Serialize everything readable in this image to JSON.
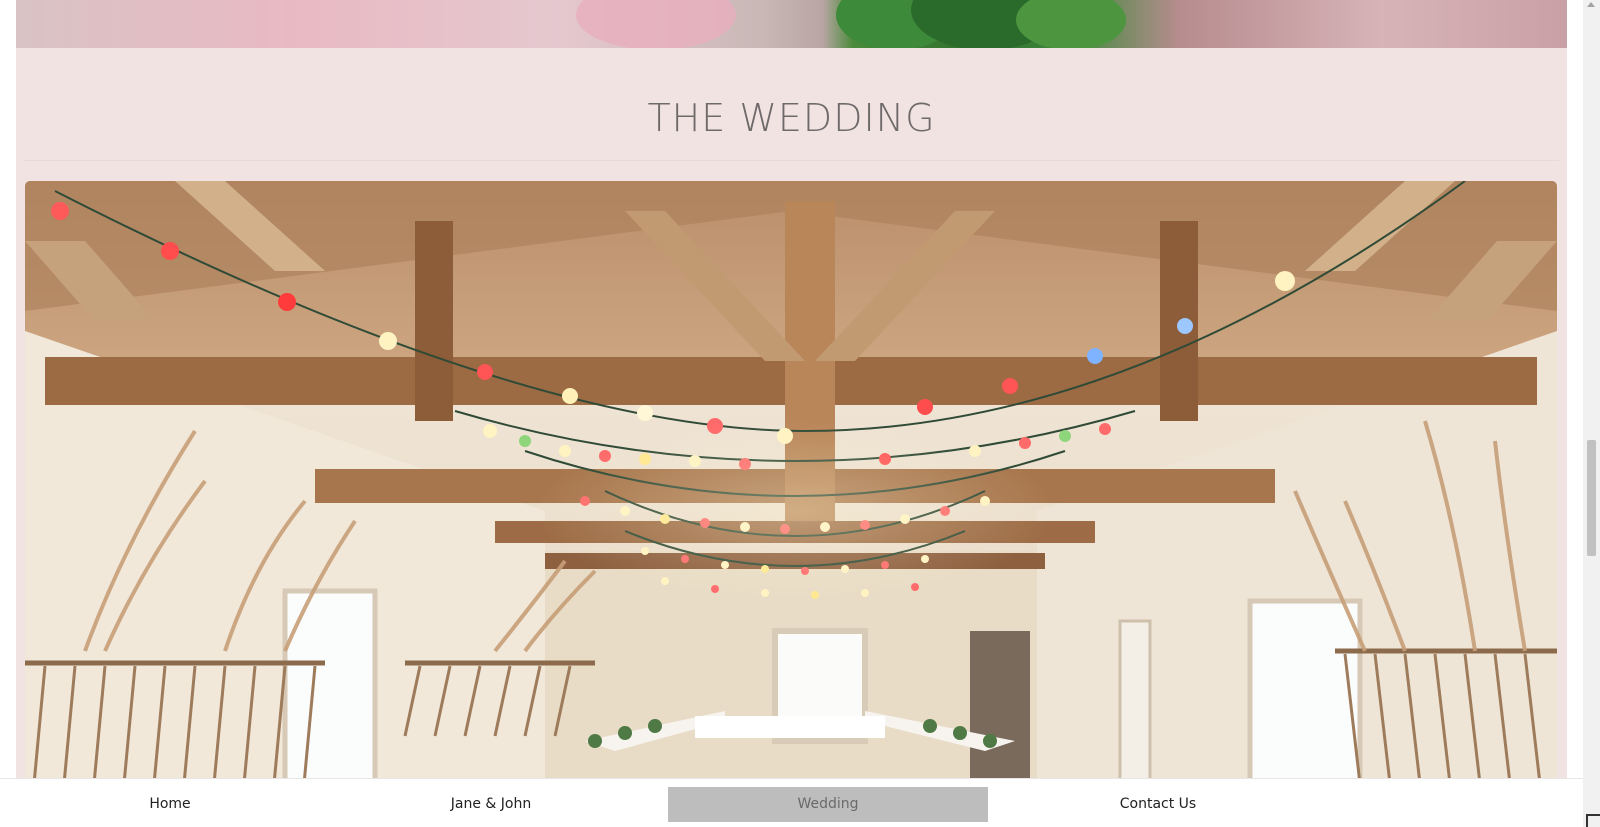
{
  "section": {
    "title": "THE WEDDING"
  },
  "images": {
    "top_photo": "flowers-photo-strip",
    "venue_photo": "barn-reception-hall-string-lights"
  },
  "nav": {
    "items": [
      {
        "label": "Home",
        "active": false
      },
      {
        "label": "Jane & John",
        "active": false
      },
      {
        "label": "Wedding",
        "active": true
      },
      {
        "label": "Contact Us",
        "active": false
      }
    ]
  },
  "colors": {
    "section_background": "#f2e3e3",
    "title_color": "#6e6a6a",
    "nav_active_background": "#bdbdbd"
  }
}
